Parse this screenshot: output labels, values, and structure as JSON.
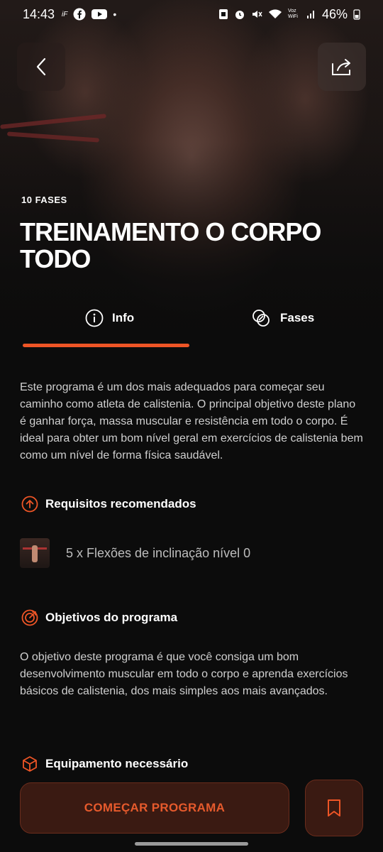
{
  "status_bar": {
    "time": "14:43",
    "left_icons": [
      "ifood-icon",
      "facebook-icon",
      "youtube-icon",
      "dot"
    ],
    "right_icons": [
      "nfc-icon",
      "alarm-icon",
      "mute-icon",
      "wifi-icon",
      "volte-icon",
      "signal-icon"
    ],
    "volte_label": "Voz WiFi",
    "battery": "46%"
  },
  "header": {
    "phases_count": "10 FASES",
    "title": "TREINAMENTO O CORPO TODO"
  },
  "tabs": [
    {
      "label": "Info",
      "icon": "info-icon",
      "active": true
    },
    {
      "label": "Fases",
      "icon": "phases-icon",
      "active": false
    }
  ],
  "description": "Este programa é um dos mais adequados para começar seu caminho como atleta de calistenia. O principal objetivo deste plano é ganhar força, massa muscular e resistência em todo o corpo. É ideal para obter um bom nível geral em exercícios de calistenia bem como um nível de forma física saudável.",
  "requirements": {
    "heading": "Requisitos recomendados",
    "items": [
      {
        "label": "5 x Flexões de inclinação nível 0"
      }
    ]
  },
  "objectives": {
    "heading": "Objetivos do programa",
    "text": "O objetivo deste programa é que você consiga um bom desenvolvimento muscular em todo o corpo e aprenda exercícios básicos de calistenia, dos mais simples aos mais avançados."
  },
  "equipment": {
    "heading": "Equipamento necessário"
  },
  "actions": {
    "start_label": "COMEÇAR PROGRAMA"
  },
  "colors": {
    "accent": "#ee5526",
    "background": "#0c0c0c",
    "button_bg": "#3a1a12"
  }
}
